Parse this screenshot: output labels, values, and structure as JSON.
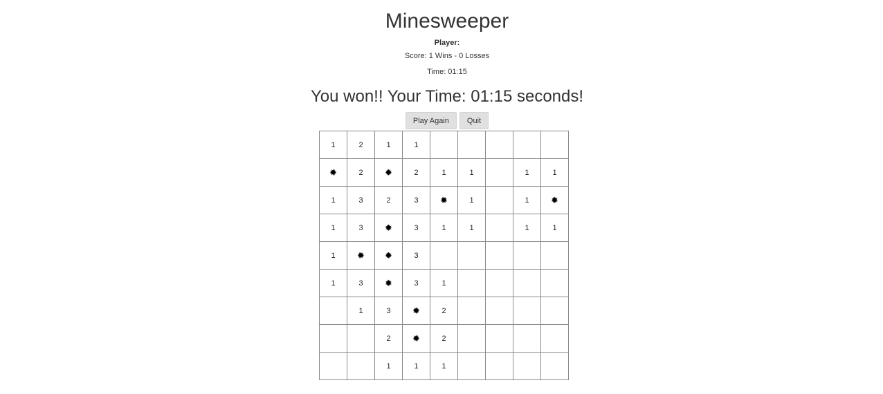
{
  "title": "Minesweeper",
  "player_label": "Player:",
  "score_text": "Score: 1 Wins - 0 Losses",
  "time_text": "Time: 01:15",
  "win_message": "You won!! Your Time: 01:15 seconds!",
  "buttons": {
    "play_again": "Play Again",
    "quit": "Quit"
  },
  "mine_symbol": "✹",
  "board": [
    [
      "1",
      "2",
      "1",
      "1",
      "",
      "",
      "",
      "",
      ""
    ],
    [
      "*",
      "2",
      "*",
      "2",
      "1",
      "1",
      "",
      "1",
      "1"
    ],
    [
      "1",
      "3",
      "2",
      "3",
      "*",
      "1",
      "",
      "1",
      "*"
    ],
    [
      "1",
      "3",
      "*",
      "3",
      "1",
      "1",
      "",
      "1",
      "1"
    ],
    [
      "1",
      "*",
      "*",
      "3",
      "",
      "",
      "",
      "",
      ""
    ],
    [
      "1",
      "3",
      "*",
      "3",
      "1",
      "",
      "",
      "",
      ""
    ],
    [
      "",
      "1",
      "3",
      "*",
      "2",
      "",
      "",
      "",
      ""
    ],
    [
      "",
      "",
      "2",
      "*",
      "2",
      "",
      "",
      "",
      ""
    ],
    [
      "",
      "",
      "1",
      "1",
      "1",
      "",
      "",
      "",
      ""
    ]
  ]
}
